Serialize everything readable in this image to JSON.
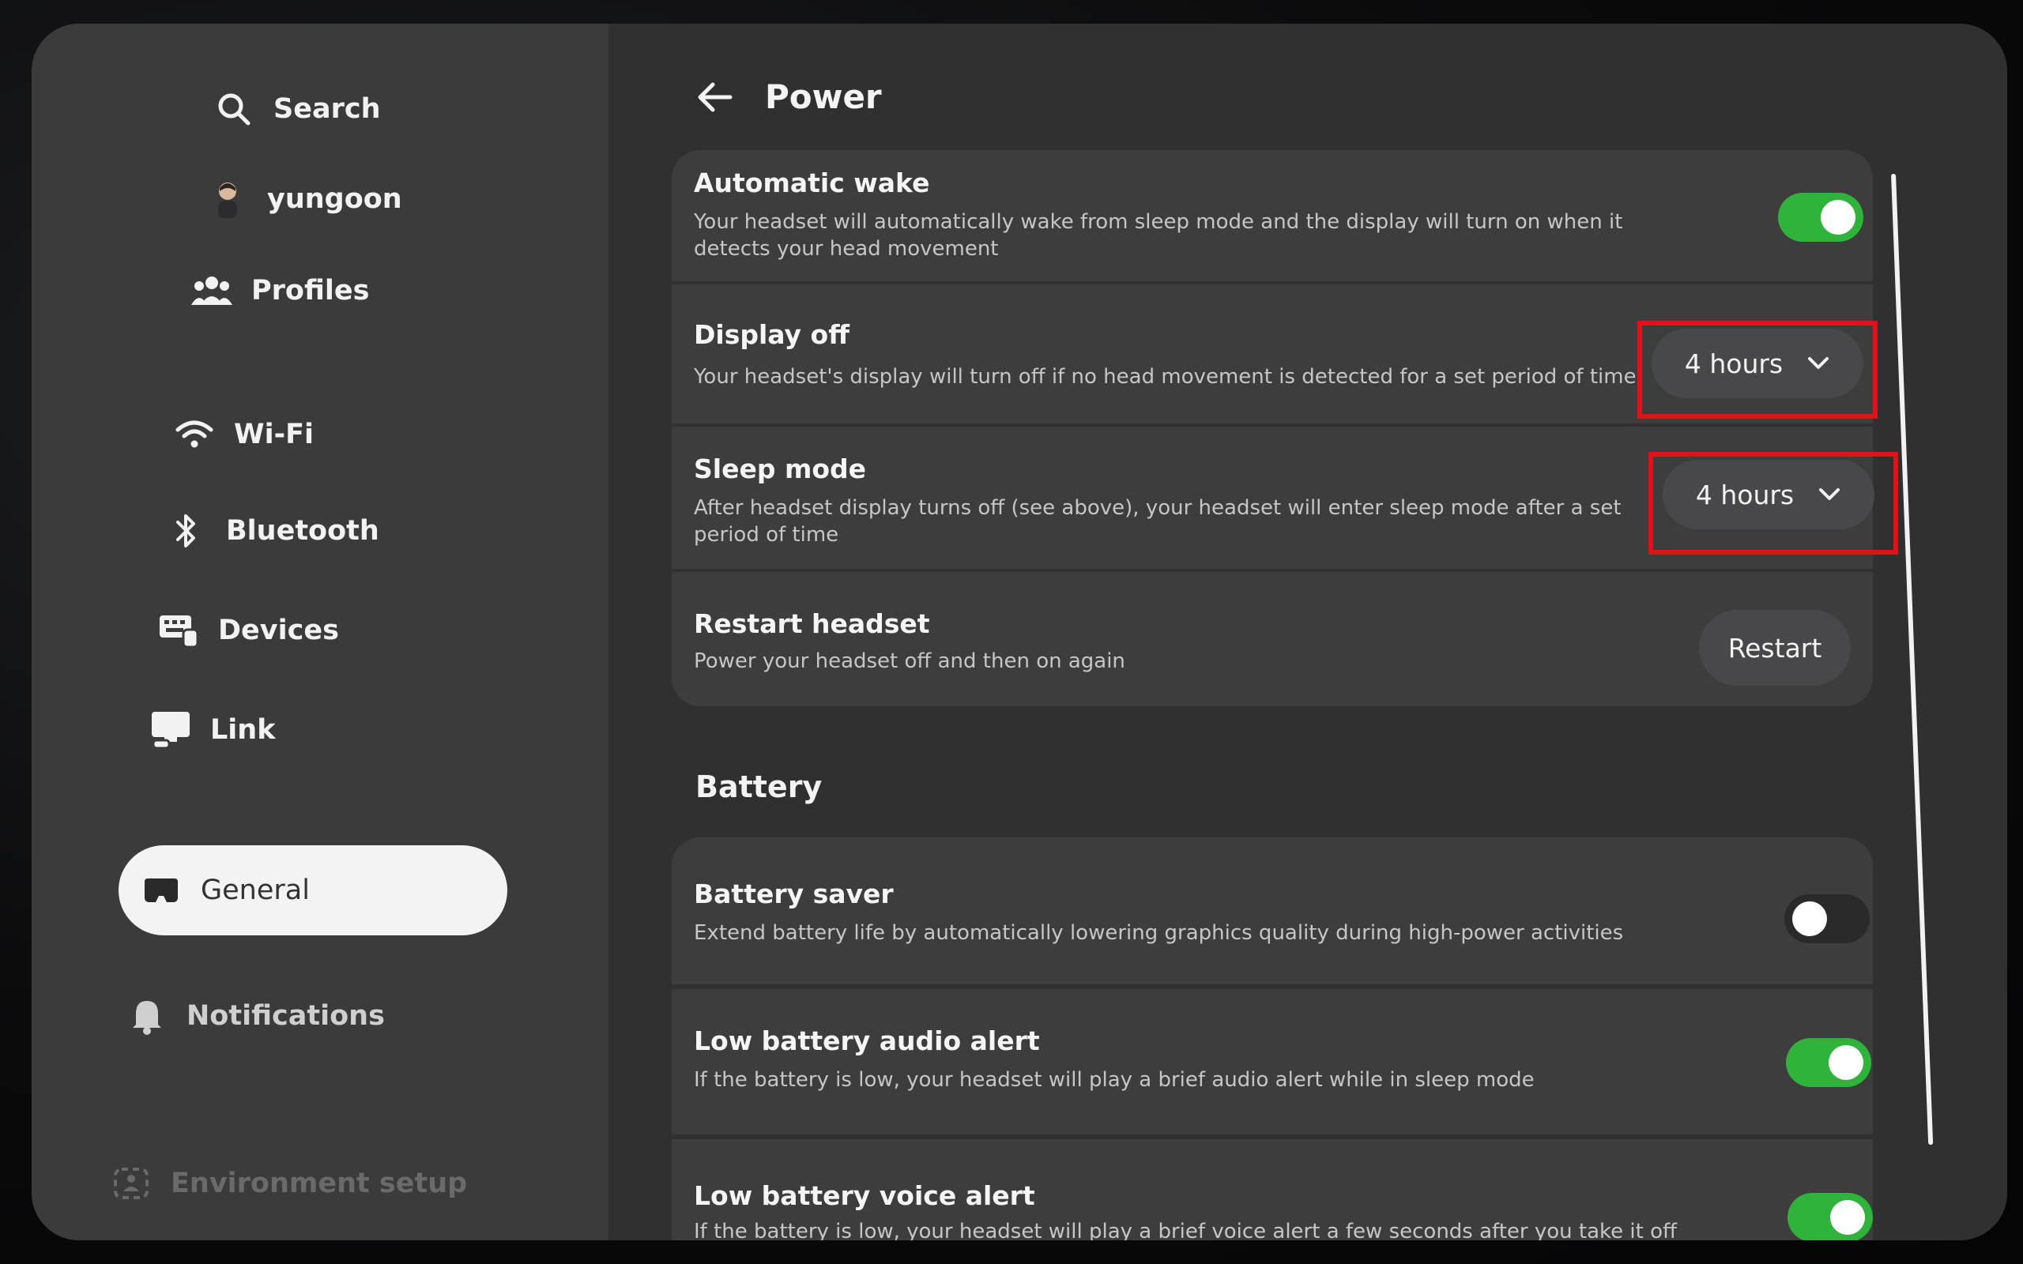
{
  "sidebar": {
    "search_label": "Search",
    "user_label": "yungoon",
    "profiles_label": "Profiles",
    "wifi_label": "Wi-Fi",
    "bluetooth_label": "Bluetooth",
    "devices_label": "Devices",
    "link_label": "Link",
    "general_label": "General",
    "notifications_label": "Notifications",
    "environment_label": "Environment setup"
  },
  "header": {
    "title": "Power"
  },
  "power": {
    "automatic_wake": {
      "title": "Automatic wake",
      "desc": "Your headset will automatically wake from sleep mode and the display will turn on when it detects your head movement",
      "enabled": true
    },
    "display_off": {
      "title": "Display off",
      "desc": "Your headset's display will turn off if no head movement is detected for a set period of time",
      "value": "4 hours"
    },
    "sleep_mode": {
      "title": "Sleep mode",
      "desc": "After headset display turns off (see above), your headset will enter sleep mode after a set period of time",
      "value": "4 hours"
    },
    "restart": {
      "title": "Restart headset",
      "desc": "Power your headset off and then on again",
      "button_label": "Restart"
    }
  },
  "battery": {
    "section_title": "Battery",
    "battery_saver": {
      "title": "Battery saver",
      "desc": "Extend battery life by automatically lowering graphics quality during high-power activities",
      "enabled": false
    },
    "low_audio": {
      "title": "Low battery audio alert",
      "desc": "If the battery is low, your headset will play a brief audio alert while in sleep mode",
      "enabled": true
    },
    "low_voice": {
      "title": "Low battery voice alert",
      "desc": "If the battery is low, your headset will play a brief voice alert a few seconds after you take it off",
      "enabled": true
    }
  },
  "colors": {
    "toggle_on": "#2fb33a",
    "highlight": "#e3101a"
  }
}
